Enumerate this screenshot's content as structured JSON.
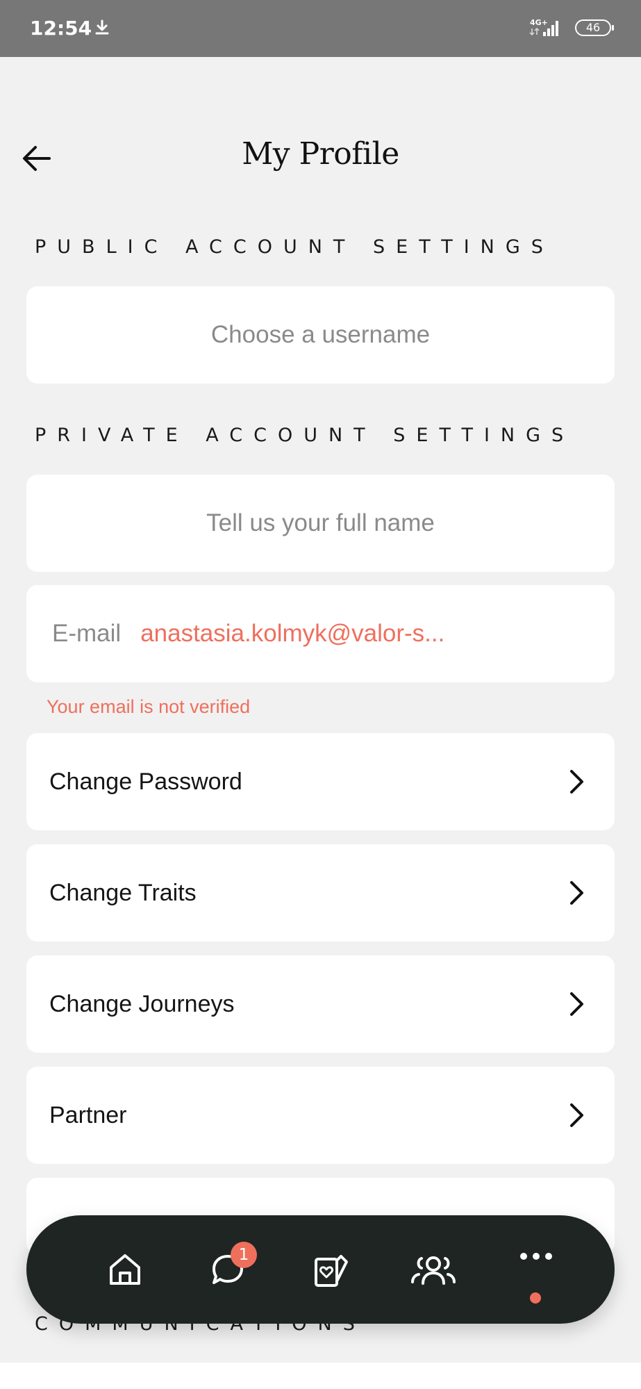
{
  "status_bar": {
    "time": "12:54",
    "network": "4G+",
    "battery": "46"
  },
  "header": {
    "title": "My Profile"
  },
  "public_section": {
    "title": "PUBLIC ACCOUNT SETTINGS",
    "username_placeholder": "Choose a username"
  },
  "private_section": {
    "title": "PRIVATE ACCOUNT SETTINGS",
    "full_name_placeholder": "Tell us your full name",
    "email_label": "E-mail",
    "email_value": "anastasia.kolmyk@valor-s...",
    "email_warning": "Your email is not verified"
  },
  "menu": {
    "items": [
      {
        "label": "Change Password"
      },
      {
        "label": "Change Traits"
      },
      {
        "label": "Change Journeys"
      },
      {
        "label": "Partner"
      }
    ]
  },
  "communications": {
    "title": "COMMUNICATIONS"
  },
  "bottom_nav": {
    "items": [
      {
        "icon": "home-icon"
      },
      {
        "icon": "chat-icon",
        "badge": "1"
      },
      {
        "icon": "cards-icon"
      },
      {
        "icon": "community-icon"
      },
      {
        "icon": "more-icon"
      }
    ]
  },
  "colors": {
    "accent": "#ef6f5d",
    "nav_background": "#1f2523",
    "page_background": "#f1f1f1"
  }
}
